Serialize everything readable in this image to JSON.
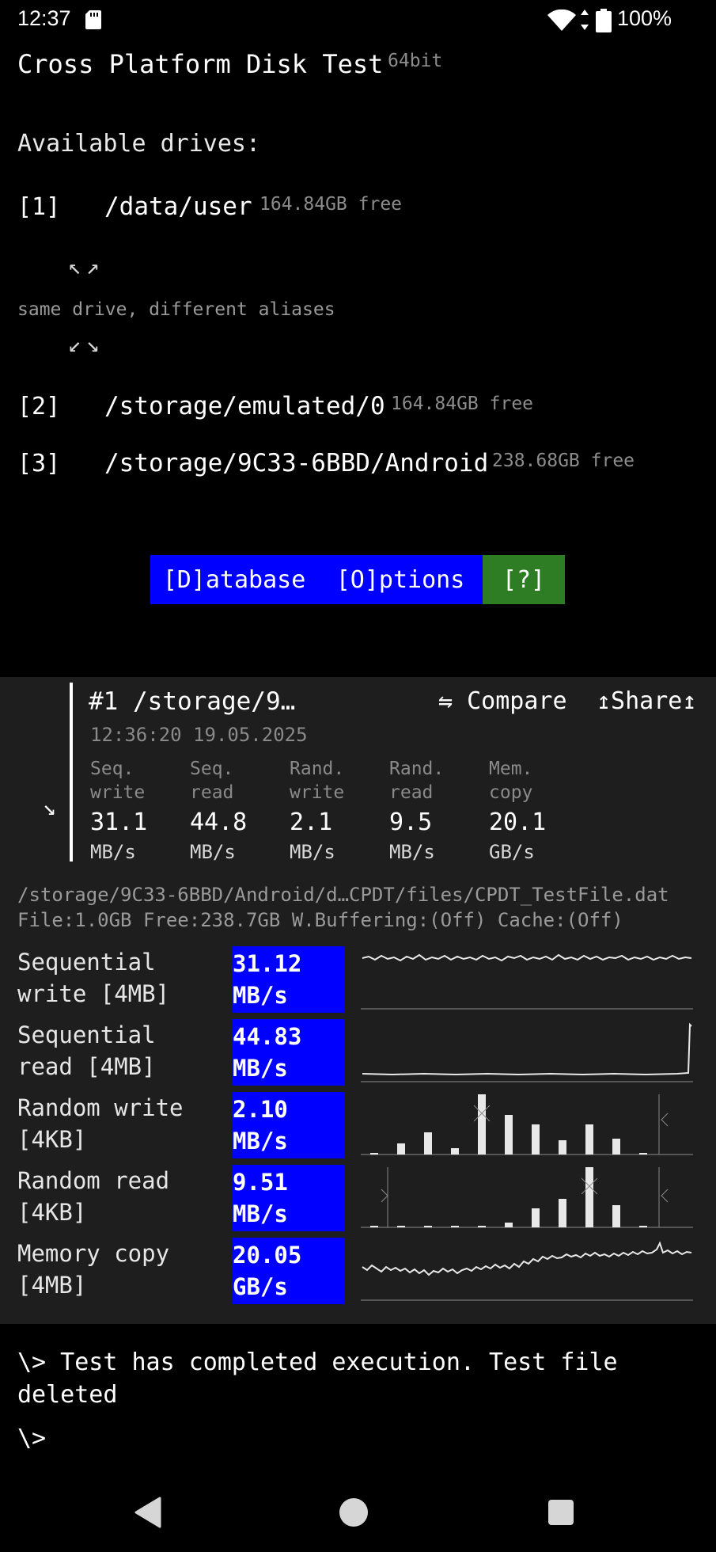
{
  "status_bar": {
    "time": "12:37",
    "battery": "100%"
  },
  "app": {
    "title": "Cross Platform Disk Test",
    "arch": "64bit"
  },
  "drives": {
    "heading": "Available drives:",
    "items": [
      {
        "index": "[1]",
        "path": "/data/user",
        "free": "164.84GB free"
      },
      {
        "index": "[2]",
        "path": "/storage/emulated/0",
        "free": "164.84GB free"
      },
      {
        "index": "[3]",
        "path": "/storage/9C33-6BBD/Android",
        "free": "238.68GB free"
      }
    ],
    "arrows_up": "↖↗",
    "arrows_down": "↙↘",
    "alias_note": "same drive, different aliases"
  },
  "buttons": {
    "database": "[D]atabase",
    "options": "[O]ptions",
    "help": "[?]"
  },
  "result": {
    "title": "#1 /storage/9…",
    "compare": "⇋ Compare",
    "share": "↥Share↥",
    "timestamp": "12:36:20 19.05.2025",
    "expand_glyph": "↘",
    "metrics": [
      {
        "label1": "Seq.",
        "label2": "write",
        "value": "31.1",
        "unit": "MB/s"
      },
      {
        "label1": "Seq.",
        "label2": "read",
        "value": "44.8",
        "unit": "MB/s"
      },
      {
        "label1": "Rand.",
        "label2": "write",
        "value": "2.1",
        "unit": "MB/s"
      },
      {
        "label1": "Rand.",
        "label2": "read",
        "value": "9.5",
        "unit": "MB/s"
      },
      {
        "label1": "Mem.",
        "label2": "copy",
        "value": "20.1",
        "unit": "GB/s"
      }
    ]
  },
  "test_file": {
    "path": "/storage/9C33-6BBD/Android/d…CPDT/files/CPDT_TestFile.dat",
    "info": "File:1.0GB Free:238.7GB W.Buffering:(Off) Cache:(Off)"
  },
  "tests": [
    {
      "label1": "Sequential",
      "label2": "write [4MB]",
      "value": "31.12",
      "unit": "MB/s"
    },
    {
      "label1": "Sequential",
      "label2": "read [4MB]",
      "value": "44.83",
      "unit": "MB/s"
    },
    {
      "label1": "Random write",
      "label2": "[4KB]",
      "value": "2.10",
      "unit": "MB/s"
    },
    {
      "label1": "Random read",
      "label2": "[4KB]",
      "value": "9.51",
      "unit": "MB/s"
    },
    {
      "label1": "Memory copy",
      "label2": "[4MB]",
      "value": "20.05",
      "unit": "GB/s"
    }
  ],
  "console": {
    "line1": "\\> Test has completed execution. Test file deleted",
    "prompt": "\\>"
  },
  "colors": {
    "accent_blue": "#0000ff",
    "help_green": "#2e7d24",
    "panel_bg": "#1e1e1e"
  }
}
